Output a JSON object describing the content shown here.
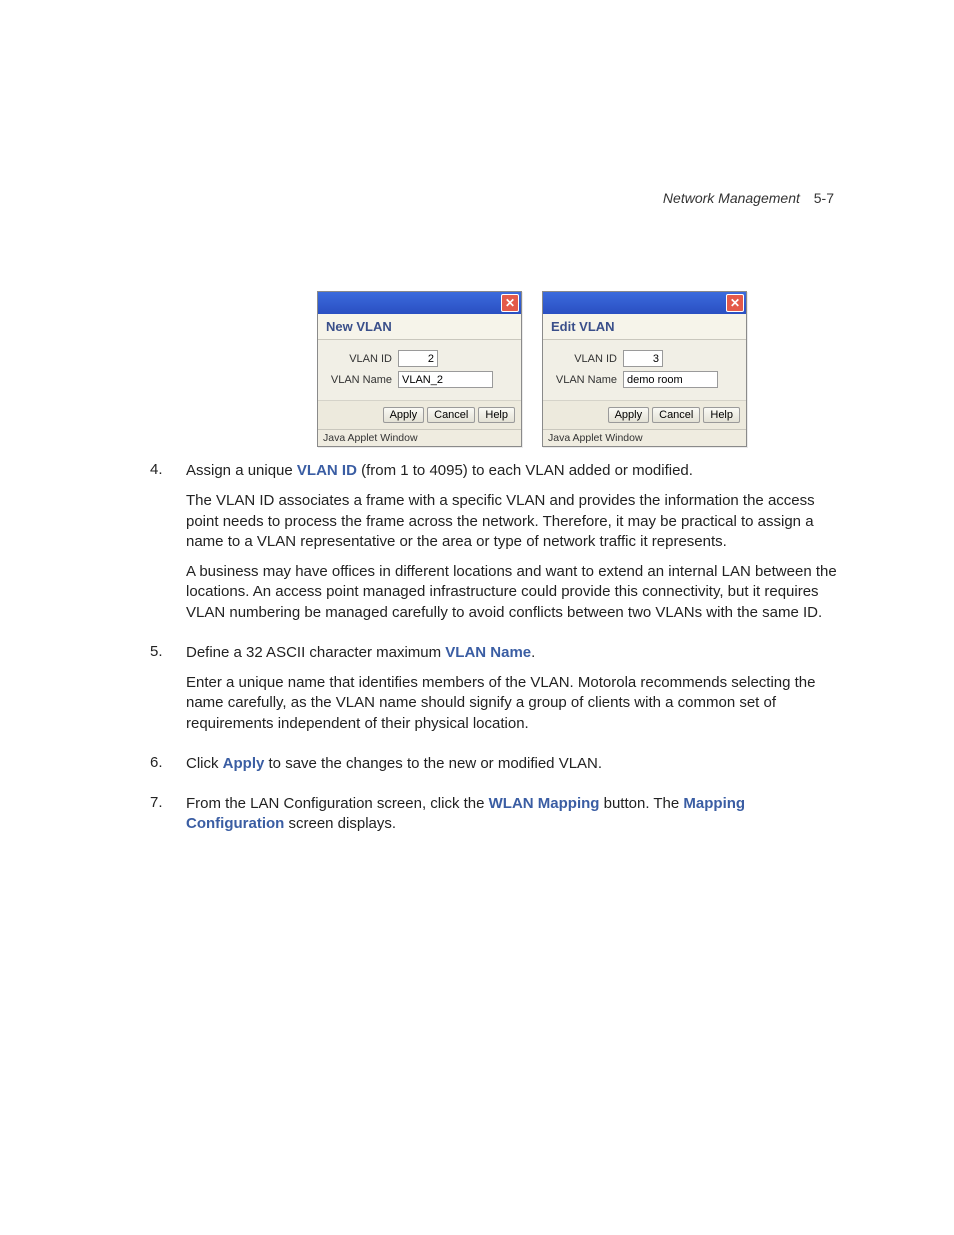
{
  "header": {
    "section": "Network Management",
    "page": "5-7"
  },
  "dialogs": {
    "new": {
      "title": "New VLAN",
      "id_label": "VLAN ID",
      "id_value": "2",
      "name_label": "VLAN Name",
      "name_value": "VLAN_2",
      "apply": "Apply",
      "cancel": "Cancel",
      "help": "Help",
      "status": "Java Applet Window",
      "close": "✕"
    },
    "edit": {
      "title": "Edit VLAN",
      "id_label": "VLAN ID",
      "id_value": "3",
      "name_label": "VLAN Name",
      "name_value": "demo room",
      "apply": "Apply",
      "cancel": "Cancel",
      "help": "Help",
      "status": "Java Applet Window",
      "close": "✕"
    }
  },
  "steps": {
    "s4": {
      "num": "4.",
      "t1a": "Assign a unique ",
      "term1": "VLAN ID",
      "t1b": " (from 1 to 4095) to each VLAN added or modified.",
      "p2": "The VLAN ID associates a frame with a specific VLAN and provides the information the access point needs to process the frame across the network. Therefore, it may be practical to assign a name to a VLAN representative or the area or type of network traffic it represents.",
      "p3": "A business may have offices in different locations and want to extend an internal LAN between the locations. An access point managed infrastructure could provide this connectivity, but it requires VLAN numbering be managed carefully to avoid conflicts between two VLANs with the same ID."
    },
    "s5": {
      "num": "5.",
      "t1a": "Define a 32 ASCII character maximum ",
      "term1": "VLAN Name",
      "t1b": ".",
      "p2": "Enter a unique name that identifies members of the VLAN. Motorola recommends selecting the name carefully, as the VLAN name should signify a group of clients with a common set of requirements independent of their physical location."
    },
    "s6": {
      "num": "6.",
      "t1a": "Click ",
      "term1": "Apply",
      "t1b": " to save the changes to the new or modified VLAN."
    },
    "s7": {
      "num": "7.",
      "t1a": "From the LAN Configuration screen, click the ",
      "term1": "WLAN Mapping",
      "t1b": " button. The ",
      "term2": "Mapping Configuration",
      "t1c": " screen displays."
    }
  }
}
